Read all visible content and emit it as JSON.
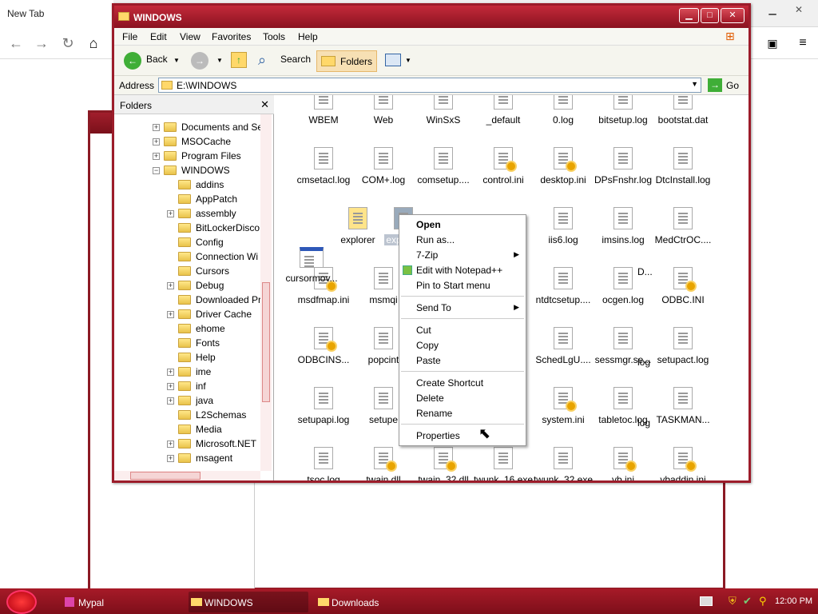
{
  "browser": {
    "tab_label": "New Tab"
  },
  "explorer": {
    "title": "WINDOWS",
    "menus": [
      "File",
      "Edit",
      "View",
      "Favorites",
      "Tools",
      "Help"
    ],
    "toolbar": {
      "back": "Back",
      "search": "Search",
      "folders": "Folders"
    },
    "address": {
      "label": "Address",
      "value": "E:\\WINDOWS",
      "go": "Go"
    },
    "folders_pane": {
      "title": "Folders",
      "items": [
        "Documents and Se",
        "MSOCache",
        "Program Files",
        "WINDOWS",
        "addins",
        "AppPatch",
        "assembly",
        "BitLockerDisco",
        "Config",
        "Connection Wi",
        "Cursors",
        "Debug",
        "Downloaded Pr",
        "Driver Cache",
        "ehome",
        "Fonts",
        "Help",
        "ime",
        "inf",
        "java",
        "L2Schemas",
        "Media",
        "Microsoft.NET",
        "msagent"
      ]
    },
    "files": [
      "WBEM",
      "Web",
      "WinSxS",
      "_default",
      "0.log",
      "bitsetup.log",
      "bootstat.dat",
      "cmsetacl.log",
      "COM+.log",
      "comsetup....",
      "control.ini",
      "desktop.ini",
      "DPsFnshr.log",
      "DtcInstall.log",
      "cursormov...",
      "explorer",
      "explorer",
      "iis6.log",
      "imsins.log",
      "MedCtrOC....",
      "msdfmap.ini",
      "msmqi",
      "ntdtcsetup....",
      "ocgen.log",
      "ODBC.INI",
      "ODBCINS...",
      "popcint",
      "SchedLgU....",
      "sessmgr.se...",
      "setupact.log",
      "setupapi.log",
      "setupe",
      "system.ini",
      "tabletoc.log",
      "TASKMAN...",
      "tsoc.log",
      "twain.dll",
      "twain_32.dll",
      "twunk_16.exe",
      "twunk_32.exe",
      "vb.ini",
      "vbaddin.ini",
      "D...",
      "log",
      "log"
    ]
  },
  "context_menu": {
    "items": [
      "Open",
      "Run as...",
      "7-Zip",
      "Edit with Notepad++",
      "Pin to Start menu",
      "Send To",
      "Cut",
      "Copy",
      "Paste",
      "Create Shortcut",
      "Delete",
      "Rename",
      "Properties"
    ]
  },
  "taskbar": {
    "items": [
      "Mypal",
      "WINDOWS",
      "Downloads"
    ],
    "clock": "12:00 PM"
  }
}
